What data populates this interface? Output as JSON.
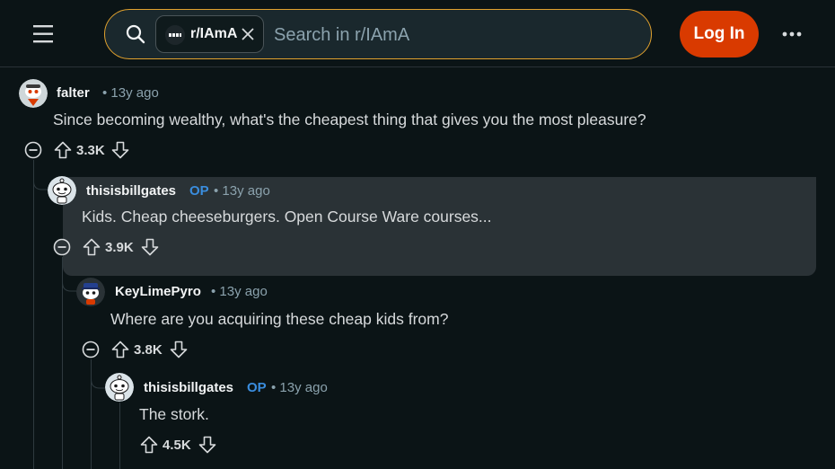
{
  "header": {
    "search": {
      "chip_label": "r/IAmA",
      "placeholder": "Search in r/IAmA"
    },
    "login_label": "Log In"
  },
  "icons": {
    "menu": "hamburger-icon",
    "search": "search-icon",
    "chip_close": "close-icon",
    "more": "more-horizontal-icon",
    "collapse": "minus-circle-icon",
    "upvote": "arrow-up-icon",
    "downvote": "arrow-down-icon"
  },
  "colors": {
    "accent_login": "#d93a00",
    "search_border": "#e0a12e",
    "op_tag": "#3a8dde",
    "background": "#0b1416",
    "highlight_bg": "#2a3236"
  },
  "comments": [
    {
      "author": "falter",
      "meta": "• 13y ago",
      "body": "Since becoming wealthy, what's the cheapest thing that gives you the most pleasure?",
      "score": "3.3K"
    },
    {
      "author": "thisisbillgates",
      "op": "OP",
      "meta": "• 13y ago",
      "body": "Kids. Cheap cheeseburgers. Open Course Ware courses...",
      "score": "3.9K"
    },
    {
      "author": "KeyLimePyro",
      "meta": "• 13y ago",
      "body": "Where are you acquiring these cheap kids from?",
      "score": "3.8K"
    },
    {
      "author": "thisisbillgates",
      "op": "OP",
      "meta": "• 13y ago",
      "body": "The stork.",
      "score": "4.5K"
    }
  ]
}
